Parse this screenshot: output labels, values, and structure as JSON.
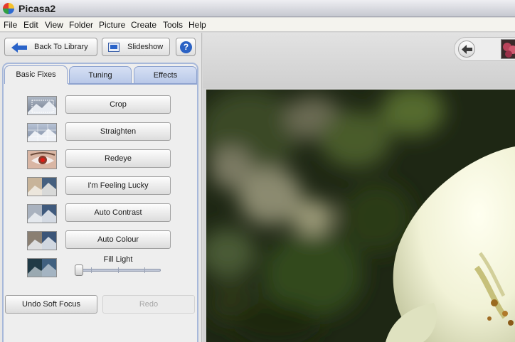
{
  "window": {
    "title": "Picasa2"
  },
  "menu": [
    "File",
    "Edit",
    "View",
    "Folder",
    "Picture",
    "Create",
    "Tools",
    "Help"
  ],
  "toolbar": {
    "back_label": "Back To Library",
    "slideshow_label": "Slideshow",
    "help_label": "?"
  },
  "tabs": [
    {
      "label": "Basic Fixes",
      "active": true
    },
    {
      "label": "Tuning",
      "active": false
    },
    {
      "label": "Effects",
      "active": false
    }
  ],
  "fixes": [
    {
      "label": "Crop",
      "icon": "crop-thumbnail"
    },
    {
      "label": "Straighten",
      "icon": "straighten-thumbnail"
    },
    {
      "label": "Redeye",
      "icon": "redeye-thumbnail"
    },
    {
      "label": "I'm Feeling Lucky",
      "icon": "feeling-lucky-thumbnail"
    },
    {
      "label": "Auto Contrast",
      "icon": "auto-contrast-thumbnail"
    },
    {
      "label": "Auto Colour",
      "icon": "auto-colour-thumbnail"
    }
  ],
  "fill_light": {
    "label": "Fill Light",
    "value": 0
  },
  "undo_label": "Undo Soft Focus",
  "redo_label": "Redo",
  "colors": {
    "accent": "#2b62c4",
    "tab_border": "#8ea3cf",
    "frame": "#a7b8da"
  }
}
